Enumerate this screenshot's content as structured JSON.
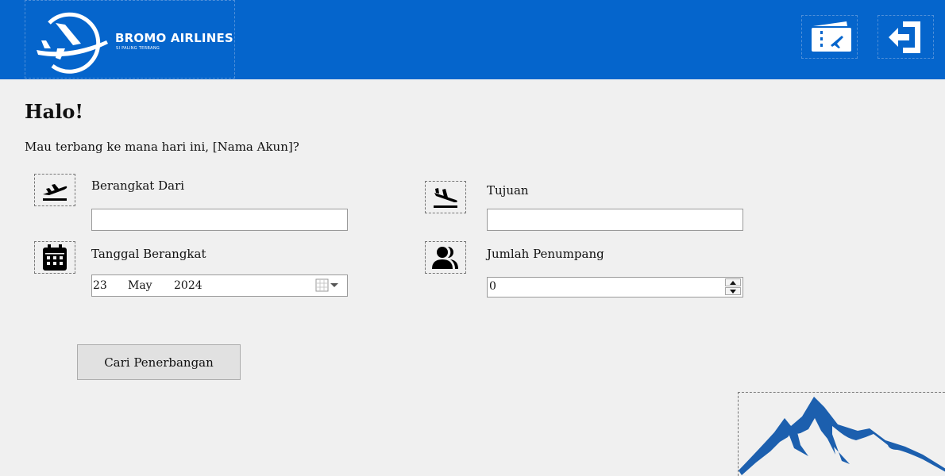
{
  "header": {
    "brand_name": "BROMO AIRLINES",
    "brand_tagline": "SI PALING TERBANG",
    "background": "#0565cc",
    "tickets_icon": "ticket-plane-icon",
    "logout_icon": "logout-icon"
  },
  "main": {
    "greeting": "Halo!",
    "subtitle": "Mau terbang ke mana hari ini, [Nama Akun]?"
  },
  "form": {
    "from_label": "Berangkat Dari",
    "from_value": "",
    "to_label": "Tujuan",
    "to_value": "",
    "date_label": "Tanggal Berangkat",
    "date_day": "23",
    "date_month": "May",
    "date_year": "2024",
    "passengers_label": "Jumlah Penumpang",
    "passengers_value": "0",
    "search_label": "Cari Penerbangan"
  },
  "colors": {
    "accent": "#0565cc",
    "mountain": "#1c5fae"
  }
}
